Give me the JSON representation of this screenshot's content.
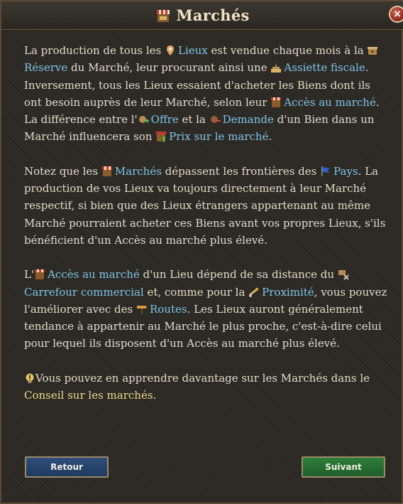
{
  "window": {
    "title": "Marchés",
    "close_symbol": "×"
  },
  "colors": {
    "keyword": "#7fc4e8",
    "gold_link": "#f1d98a",
    "body_text": "#e3dccd",
    "back_button": "#1f3a5e",
    "next_button": "#1e5f29"
  },
  "p1": {
    "t1": "La production de tous les ",
    "lieux": "Lieux",
    "t2": " est vendue chaque mois à la ",
    "reserve": "Réserve",
    "t3": " du Marché, leur procurant ainsi une ",
    "assiette": "Assiette fiscale",
    "t4": ". Inversement, tous les Lieux essaient d'acheter les Biens dont ils ont besoin auprès de leur Marché, selon leur ",
    "acces": "Accès au marché",
    "t5": ". La différence entre l'",
    "offre": "Offre",
    "t6": " et la ",
    "demande": "Demande",
    "t7": " d'un Bien dans un Marché influencera son ",
    "prix": "Prix sur le marché",
    "t8": "."
  },
  "p2": {
    "t1": "Notez que les ",
    "marches": "Marchés",
    "t2": " dépassent les frontières des ",
    "pays": "Pays",
    "t3": ". La production de vos Lieux va toujours directement à leur Marché respectif, si bien que des Lieux étrangers appartenant au même Marché pourraient acheter ces Biens avant vos propres Lieux, s'ils bénéficient d'un Accès au marché plus élevé."
  },
  "p3": {
    "t1": "L'",
    "acces": "Accès au marché",
    "t2": " d'un Lieu dépend de sa distance du ",
    "carrefour": "Carrefour commercial",
    "t3": " et, comme pour la ",
    "proximite": "Proximité",
    "t4": ", vous pouvez l'améliorer avec des ",
    "routes": "Routes",
    "t5": ". Les Lieux auront généralement tendance à appartenir au Marché le plus proche, c'est-à-dire celui pour lequel ils disposent d'un Accès au marché plus élevé."
  },
  "p4": {
    "t1": "Vous pouvez en apprendre davantage sur les Marchés dans le ",
    "conseil": "Conseil sur les marchés",
    "t2": "."
  },
  "icons": {
    "title": "market-stall-icon",
    "lieux": "location-icon",
    "reserve": "reserve-icon",
    "assiette": "tax-base-icon",
    "acces": "market-access-icon",
    "offre": "supply-icon",
    "demande": "demand-icon",
    "prix": "market-price-icon",
    "marches": "market-stall-icon",
    "pays": "flag-icon",
    "carrefour": "trade-hub-icon",
    "proximite": "proximity-icon",
    "routes": "road-sign-icon",
    "tip": "lightbulb-icon"
  },
  "buttons": {
    "back": "Retour",
    "next": "Suivant"
  }
}
